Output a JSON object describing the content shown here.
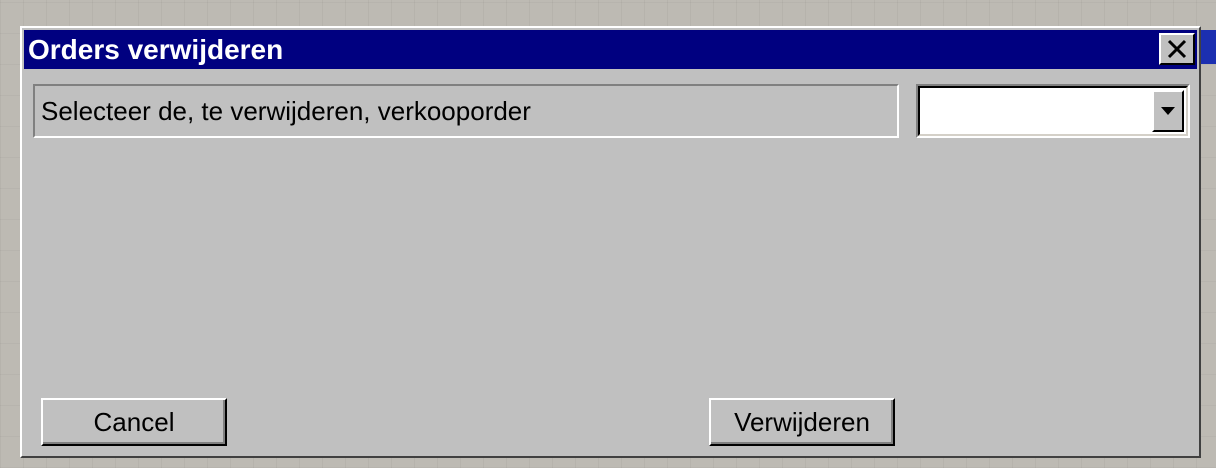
{
  "dialog": {
    "title": "Orders verwijderen",
    "close_icon": "close-icon",
    "select_label": "Selecteer de, te verwijderen, verkooporder",
    "select": {
      "value": "",
      "icon": "chevron-down-icon"
    },
    "cancel_label": "Cancel",
    "delete_label": "Verwijderen"
  },
  "colors": {
    "titlebar": "#000080",
    "title_text": "#ffffff",
    "dialog_face": "#c0c0c0"
  }
}
